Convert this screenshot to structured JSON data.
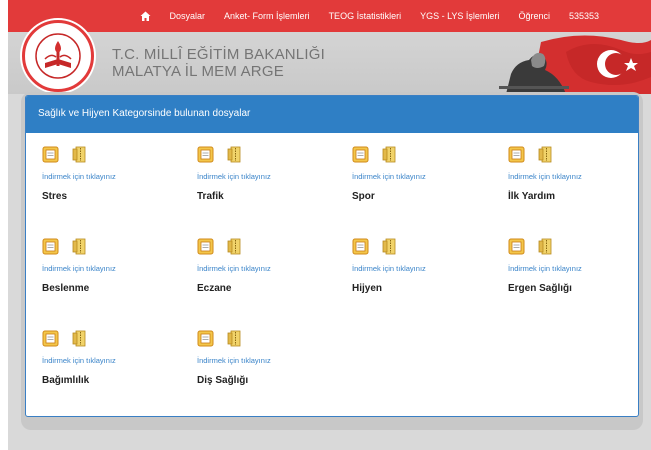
{
  "nav": {
    "items": [
      "Dosyalar",
      "Anket- Form İşlemleri",
      "TEOG İstatistikleri",
      "YGS - LYS İşlemleri",
      "Öğrenci",
      "535353"
    ]
  },
  "header": {
    "logo_text": "T.C. MİLLİ EĞİTİM BAKANLIĞI",
    "title_line1": "T.C. MİLLÎ EĞİTİM BAKANLIĞI",
    "title_line2": "MALATYA İL MEM ARGE"
  },
  "panel": {
    "heading": "Sağlık ve Hijyen Kategorsinde bulunan dosyalar",
    "download_label": "İndirmek için tıklayınız",
    "files": [
      "Stres",
      "Trafik",
      "Spor",
      "İlk Yardım",
      "Beslenme",
      "Eczane",
      "Hijyen",
      "Ergen Sağlığı",
      "Bağımlılık",
      "Diş Sağlığı"
    ]
  },
  "colors": {
    "nav_bg": "#e23a3a",
    "panel_heading_bg": "#2f7fc5",
    "link": "#3a84c9"
  }
}
